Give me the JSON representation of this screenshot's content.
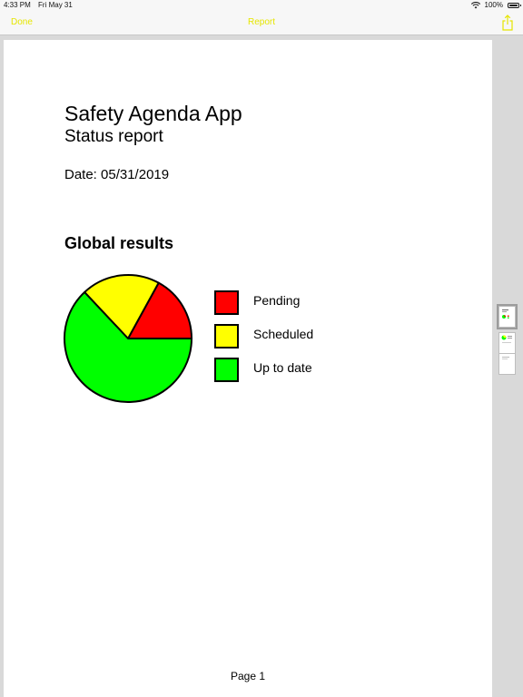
{
  "status_bar": {
    "time": "4:33 PM",
    "date": "Fri May 31",
    "battery": "100%"
  },
  "nav": {
    "done_label": "Done",
    "title": "Report",
    "share_icon": "share-icon",
    "accent_color": "#e6e600"
  },
  "document": {
    "title": "Safety Agenda App",
    "subtitle": "Status report",
    "date_line": "Date: 05/31/2019",
    "section_heading": "Global results",
    "page_label": "Page 1"
  },
  "chart_data": {
    "type": "pie",
    "categories": [
      "Pending",
      "Scheduled",
      "Up to date"
    ],
    "values": [
      17,
      20,
      63
    ],
    "colors": [
      "#ff0000",
      "#ffff00",
      "#00ff00"
    ],
    "legend_position": "right",
    "start_angle_deg": 0,
    "direction": "counterclockwise"
  },
  "legend": {
    "items": [
      {
        "label": "Pending",
        "color": "#ff0000"
      },
      {
        "label": "Scheduled",
        "color": "#ffff00"
      },
      {
        "label": "Up to date",
        "color": "#00ff00"
      }
    ]
  },
  "thumbnails": {
    "count": 3,
    "selected_index": 0
  }
}
